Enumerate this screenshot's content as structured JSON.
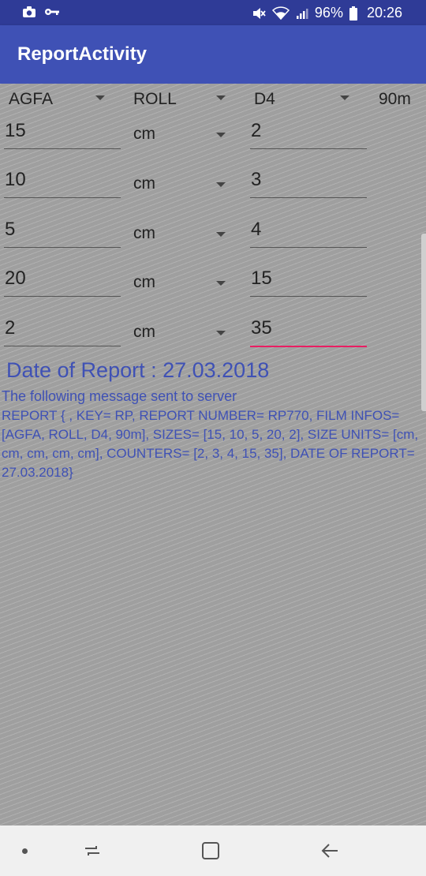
{
  "status_bar": {
    "battery": "96%",
    "time": "20:26",
    "icons": [
      "camera-icon",
      "key-icon",
      "mute-icon",
      "wifi-icon",
      "signal-icon",
      "battery-icon"
    ]
  },
  "app_bar": {
    "title": "ReportActivity"
  },
  "film_info": {
    "brand": "AGFA",
    "type": "ROLL",
    "process": "D4",
    "length": "90m"
  },
  "rows": [
    {
      "size": "15",
      "unit": "cm",
      "counter": "2"
    },
    {
      "size": "10",
      "unit": "cm",
      "counter": "3"
    },
    {
      "size": "5",
      "unit": "cm",
      "counter": "4"
    },
    {
      "size": "20",
      "unit": "cm",
      "counter": "15"
    },
    {
      "size": "2",
      "unit": "cm",
      "counter": "35"
    }
  ],
  "report": {
    "date_line": "Date of Report : 27.03.2018",
    "message_title": "The following message sent to server",
    "message_body": " REPORT { , KEY= RP, REPORT NUMBER= RP770, FILM INFOS= [AGFA, ROLL, D4, 90m], SIZES= [15, 10, 5, 20, 2], SIZE UNITS= [cm, cm, cm, cm, cm], COUNTERS= [2, 3, 4, 15, 35], DATE OF REPORT= 27.03.2018}"
  },
  "colors": {
    "primary": "#3f51b5",
    "primary_dark": "#2f3b97",
    "accent": "#e91e63"
  },
  "nav_bar": {
    "icons": [
      "recent-apps-icon",
      "home-icon",
      "back-icon"
    ]
  }
}
